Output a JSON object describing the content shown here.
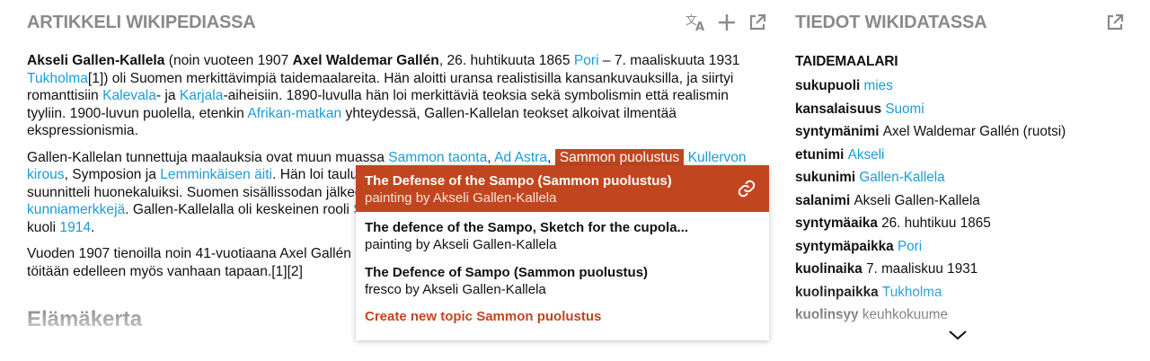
{
  "left_panel": {
    "title": "ARTIKKELI WIKIPEDIASSA",
    "tools": [
      "translate-icon",
      "plus-icon",
      "open-external-icon"
    ],
    "paragraph1": [
      {
        "t": "Akseli Gallen-Kallela",
        "s": "b"
      },
      {
        "t": " (noin vuoteen 1907 ",
        "s": ""
      },
      {
        "t": "Axel Waldemar Gallén",
        "s": "b"
      },
      {
        "t": ", 26. huhtikuuta 1865 ",
        "s": ""
      },
      {
        "t": "Pori",
        "s": "a"
      },
      {
        "t": " – 7. maaliskuuta 1931 ",
        "s": ""
      },
      {
        "t": "Tukholma",
        "s": "a"
      },
      {
        "t": "[1]) oli Suomen merkittävimpiä taidemaalareita. Hän aloitti uransa realistisilla kansankuvauksilla, ja siirtyi romanttisiin ",
        "s": ""
      },
      {
        "t": "Kalevala",
        "s": "a"
      },
      {
        "t": "- ja ",
        "s": ""
      },
      {
        "t": "Karjala",
        "s": "a"
      },
      {
        "t": "-aiheisiin. 1890-luvulla hän loi merkittäviä teoksia sekä symbolismin että realismin tyyliin. 1900-luvun puolella, etenkin ",
        "s": ""
      },
      {
        "t": "Afrikan-matkan",
        "s": "a"
      },
      {
        "t": " yhteydessä, Gallen-Kallelan teokset alkoivat ilmentää ekspressionismia.",
        "s": ""
      }
    ],
    "paragraph2": [
      {
        "t": "Gallen-Kallelan tunnettuja maalauksia ovat muun muassa ",
        "s": ""
      },
      {
        "t": "Sammon taonta",
        "s": "a"
      },
      {
        "t": ", ",
        "s": ""
      },
      {
        "t": "Ad Astra",
        "s": "a"
      },
      {
        "t": ", ",
        "s": ""
      },
      {
        "t": "Sammon puolustus",
        "s": "h"
      },
      {
        "t": " ",
        "s": ""
      },
      {
        "t": "Kullervon kirous",
        "s": "a"
      },
      {
        "t": ", Symposion ja ",
        "s": ""
      },
      {
        "t": "Lemminkäisen äiti",
        "s": "a"
      },
      {
        "t": ". Hän loi taulujen ohella merkittäviä teoksia myös julkisiin rakennuksiin sekä suunnitteli huonekaluiksi. Suomen sisällissodan jälkeen Gallen-Kallela suunnitteli ",
        "s": ""
      },
      {
        "t": "Suomen armeijan univormuja",
        "s": "a"
      },
      {
        "t": " ja ",
        "s": ""
      },
      {
        "t": "kunniamerkkejä",
        "s": "a"
      },
      {
        "t": ". Gallen-Kallelalla oli keskeinen rooli ",
        "s": ""
      },
      {
        "t": "Suomen paviljongissa Pariisin maailmannäyttelyssä 1900",
        "s": "a"
      },
      {
        "t": " ja hän kuoli ",
        "s": ""
      },
      {
        "t": "1914",
        "s": "a"
      },
      {
        "t": ".",
        "s": ""
      }
    ],
    "paragraph3": [
      {
        "t": "Vuoden 1907 tienoilla noin 41-vuotiaana Axel Gallén suomensi nimensä Akseli Gallen-Kallelaksi, mutta allekirjoitti töitään edelleen myös vanhaan tapaan.[1][2]",
        "s": ""
      }
    ],
    "section_heading": "Elämäkerta"
  },
  "popup": {
    "options": [
      {
        "title": "The Defense of the Sampo (Sammon puolustus)",
        "desc": "painting by Akseli Gallen-Kallela",
        "selected": true
      },
      {
        "title": "The defence of the Sampo, Sketch for the cupola...",
        "desc": "painting by Akseli Gallen-Kallela",
        "selected": false
      },
      {
        "title": "The Defence of Sampo (Sammon puolustus)",
        "desc": "fresco by Akseli Gallen-Kallela",
        "selected": false
      }
    ],
    "create_label": "Create new topic Sammon puolustus"
  },
  "right_panel": {
    "title": "TIEDOT WIKIDATASSA",
    "type": "TAIDEMAALARI",
    "facts": [
      {
        "k": "sukupuoli",
        "v": "mies",
        "link": true
      },
      {
        "k": "kansalaisuus",
        "v": "Suomi",
        "link": true
      },
      {
        "k": "syntymänimi",
        "v": "Axel Waldemar Gallén (ruotsi)",
        "link": false
      },
      {
        "k": "etunimi",
        "v": "Akseli",
        "link": true
      },
      {
        "k": "sukunimi",
        "v": "Gallen-Kallela",
        "link": true
      },
      {
        "k": "salanimi",
        "v": "Akseli Gallen-Kallela",
        "link": false
      },
      {
        "k": "syntymäaika",
        "v": "26. huhtikuu 1865",
        "link": false
      },
      {
        "k": "syntymäpaikka",
        "v": "Pori",
        "link": true
      },
      {
        "k": "kuolinaika",
        "v": "7. maaliskuu 1931",
        "link": false
      },
      {
        "k": "kuolinpaikka",
        "v": "Tukholma",
        "link": true
      },
      {
        "k": "kuolinsyy",
        "v": "keuhkokuume",
        "link": false
      }
    ]
  },
  "colors": {
    "accent": "#c1461f",
    "link": "#1a9cd8",
    "title_gray": "#8a8a8a"
  }
}
